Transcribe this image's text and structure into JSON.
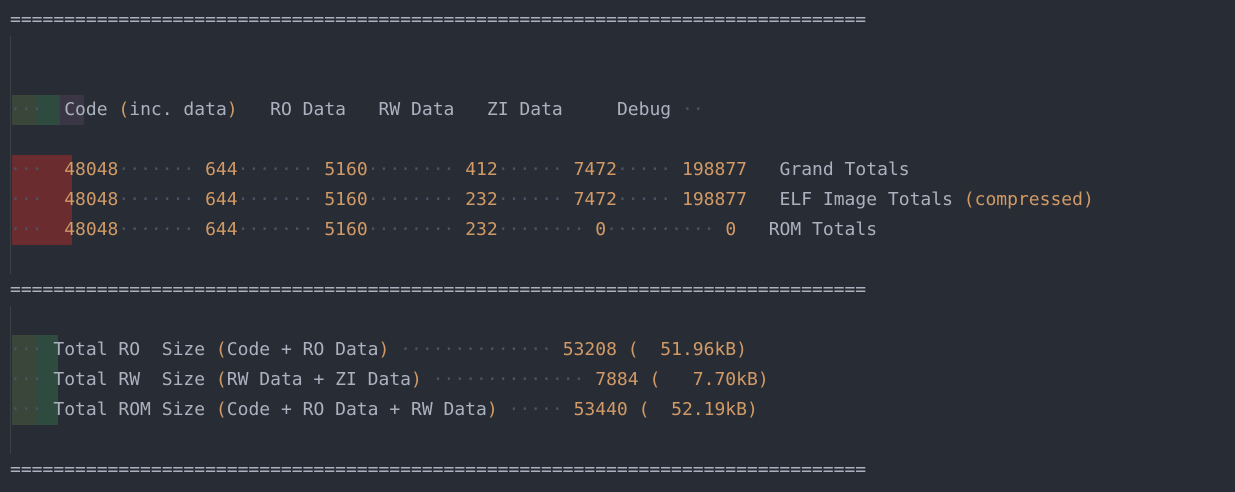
{
  "separator": "===============================================================================",
  "header": {
    "code": "Code",
    "inc_open": "(",
    "inc": "inc. data",
    "inc_close": ")",
    "ro_data": "RO Data",
    "rw_data": "RW Data",
    "zi_data": "ZI Data",
    "debug": "Debug"
  },
  "rows": [
    {
      "code": "48048",
      "inc": "644",
      "ro": "5160",
      "rw": "412",
      "zi": "7472",
      "debug": "198877",
      "label": "Grand Totals",
      "extra_open": "",
      "extra": "",
      "extra_close": ""
    },
    {
      "code": "48048",
      "inc": "644",
      "ro": "5160",
      "rw": "232",
      "zi": "7472",
      "debug": "198877",
      "label": "ELF Image Totals",
      "extra_open": "(",
      "extra": "compressed",
      "extra_close": ")"
    },
    {
      "code": "48048",
      "inc": "644",
      "ro": "5160",
      "rw": "232",
      "zi": "0",
      "debug": "0",
      "label": "ROM Totals",
      "extra_open": "",
      "extra": "",
      "extra_close": ""
    }
  ],
  "totals": [
    {
      "label": "Total RO  Size",
      "paren_open": "(",
      "desc": "Code + RO Data",
      "paren_close": ")",
      "value": "53208",
      "kb_open": "(",
      "kb": "51.96kB",
      "kb_close": ")"
    },
    {
      "label": "Total RW  Size",
      "paren_open": "(",
      "desc": "RW Data + ZI Data",
      "paren_close": ")",
      "value": "7884",
      "kb_open": "(",
      "kb": "7.70kB",
      "kb_close": ")"
    },
    {
      "label": "Total ROM Size",
      "paren_open": "(",
      "desc": "Code + RO Data + RW Data",
      "paren_close": ")",
      "value": "53440",
      "kb_open": "(",
      "kb": "52.19kB",
      "kb_close": ")"
    }
  ],
  "colors": {
    "background": "#282c34",
    "text": "#abb2bf",
    "number": "#d19a66",
    "whitespace_dots": "#4b5263"
  }
}
